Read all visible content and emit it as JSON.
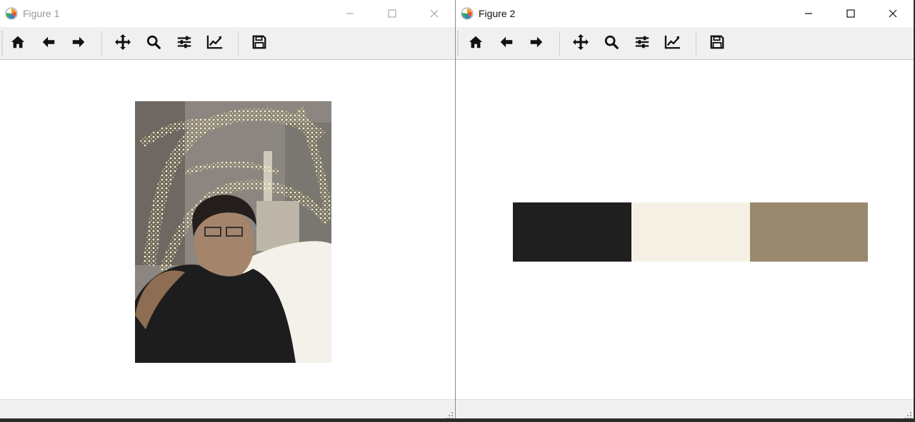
{
  "windows": [
    {
      "title": "Figure 1",
      "toolbar": [
        "home-icon",
        "back-arrow-icon",
        "forward-arrow-icon",
        "pan-icon",
        "zoom-icon",
        "configure-subplots-icon",
        "edit-axes-icon",
        "save-icon"
      ],
      "status_text": ""
    },
    {
      "title": "Figure 2",
      "toolbar": [
        "home-icon",
        "back-arrow-icon",
        "forward-arrow-icon",
        "pan-icon",
        "zoom-icon",
        "configure-subplots-icon",
        "edit-axes-icon",
        "save-icon"
      ],
      "status_text": ""
    }
  ],
  "figure2": {
    "swatch_colors": [
      "#1f1f1f",
      "#f4f1e4",
      "#98896f"
    ]
  },
  "colors": {
    "toolbar_bg": "#f0f0f0",
    "inactive_title": "#9a9a9a",
    "active_title": "#111111"
  }
}
